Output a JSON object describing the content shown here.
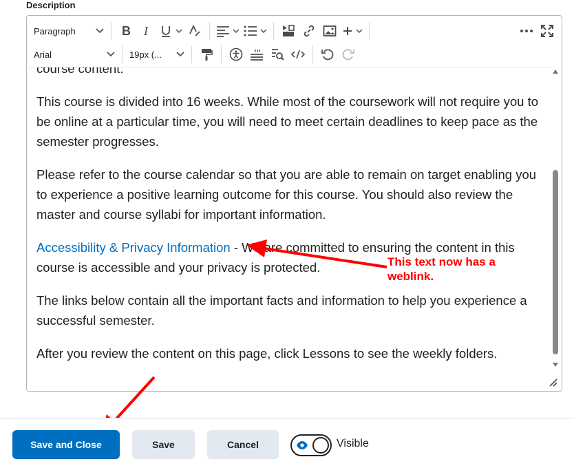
{
  "description_label": "Description",
  "toolbar": {
    "block_format": "Paragraph",
    "font_family": "Arial",
    "font_size": "19px (..."
  },
  "content": {
    "partial_line": "course content.",
    "p1": "This course is divided into 16 weeks. While most of the coursework will not require you to be online at a particular time, you will need to meet certain deadlines to keep pace as the semester progresses.",
    "p2": "Please refer to the course calendar so that you are able to remain on target enabling you to experience a positive learning outcome for this course. You should also review the master and course syllabi for important information.",
    "link_text": "Accessibility & Privacy Information",
    "p3_rest": " - We are committed to ensuring the content in this course is accessible and your privacy is protected.",
    "p4": "The links below contain all the important facts and information to help you experience a successful semester.",
    "p5": "After you review the content on this page, click Lessons to see the weekly folders."
  },
  "annotation": "This text now has a weblink.",
  "footer": {
    "save_close": "Save and Close",
    "save": "Save",
    "cancel": "Cancel",
    "visibility": "Visible"
  },
  "colors": {
    "primary": "#006fbf",
    "link": "#006fbf",
    "annotation": "#ff0000"
  }
}
